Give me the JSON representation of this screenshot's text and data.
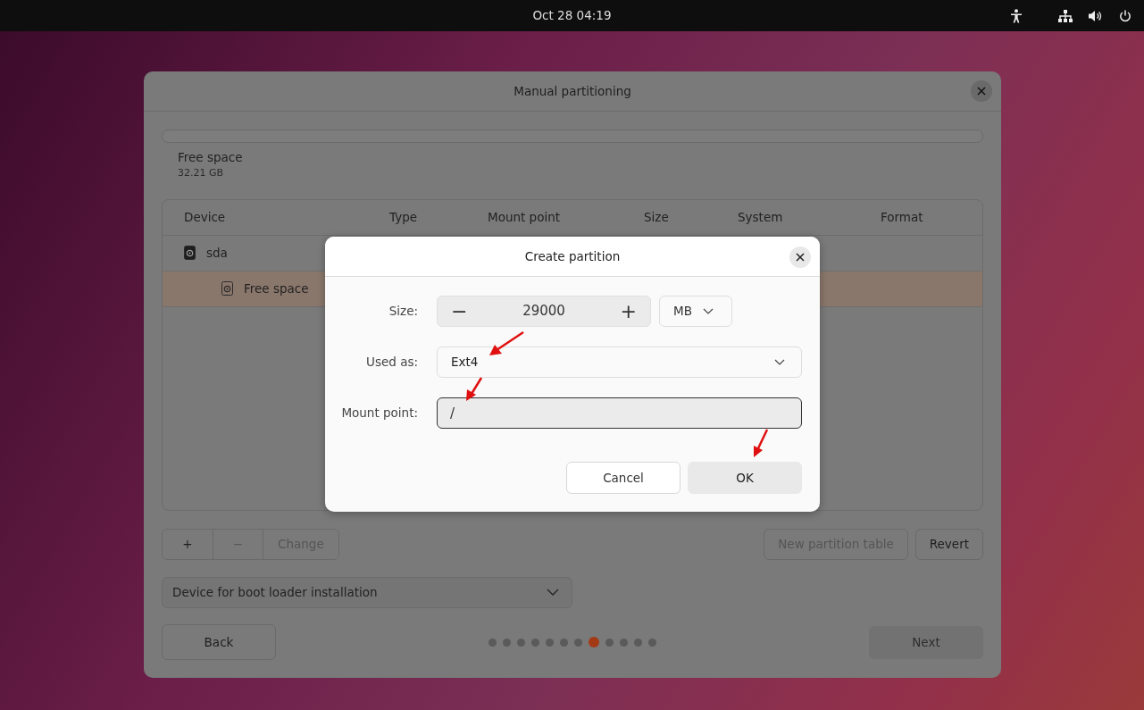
{
  "top_bar": {
    "clock": "Oct 28  04:19"
  },
  "window": {
    "title": "Manual partitioning",
    "free_space": {
      "label": "Free space",
      "size": "32.21 GB"
    },
    "table": {
      "columns": [
        "Device",
        "Type",
        "Mount point",
        "Size",
        "System",
        "Format"
      ],
      "rows": [
        {
          "device": "sda",
          "selected": false,
          "children": [
            {
              "device": "Free space",
              "selected": true
            }
          ]
        }
      ]
    },
    "edit_buttons": [
      {
        "label": "+",
        "disabled": false
      },
      {
        "label": "−",
        "disabled": true
      },
      {
        "label": "Change",
        "disabled": true
      }
    ],
    "table_buttons": [
      {
        "label": "New partition table",
        "disabled": true
      },
      {
        "label": "Revert",
        "disabled": false
      }
    ],
    "boot_loader": {
      "value": "Device for boot loader installation"
    },
    "back": {
      "label": "Back",
      "disabled": false
    },
    "next": {
      "label": "Next",
      "disabled": true
    },
    "steps": [
      {
        "selected": false
      },
      {
        "selected": false
      },
      {
        "selected": false
      },
      {
        "selected": false
      },
      {
        "selected": false
      },
      {
        "selected": false
      },
      {
        "selected": false
      },
      {
        "selected": true
      },
      {
        "selected": false
      },
      {
        "selected": false
      },
      {
        "selected": false
      },
      {
        "selected": false
      }
    ]
  },
  "dialog": {
    "title": "Create partition",
    "size": {
      "label": "Size:",
      "decrement": "−",
      "value": "29000",
      "increment": "+",
      "unit": "MB"
    },
    "used_as": {
      "label": "Used as:",
      "value": "Ext4"
    },
    "mount_point": {
      "label": "Mount point:",
      "value": "/"
    },
    "buttons": [
      {
        "label": "Cancel",
        "kind": "secondary"
      },
      {
        "label": "OK",
        "kind": "default"
      }
    ]
  }
}
